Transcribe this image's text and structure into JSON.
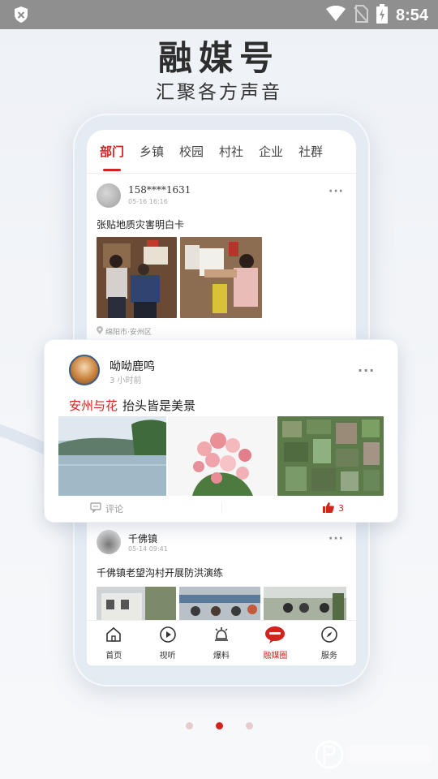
{
  "status_bar": {
    "time": "8:54"
  },
  "headline": {
    "title": "融媒号",
    "subtitle": "汇聚各方声音"
  },
  "tabs": [
    {
      "label": "部门",
      "active": true
    },
    {
      "label": "乡镇"
    },
    {
      "label": "校园"
    },
    {
      "label": "村社"
    },
    {
      "label": "企业"
    },
    {
      "label": "社群"
    }
  ],
  "post1": {
    "user": "158****1631",
    "time": "05-16 16:16",
    "title": "张贴地质灾害明白卡",
    "location": "绵阳市·安州区"
  },
  "featured_post": {
    "user": "呦呦鹿鸣",
    "time": "3 小时前",
    "tag": "安州与花",
    "title": "抬头皆是美景",
    "comment_label": "评论",
    "like_count": "3"
  },
  "post3": {
    "user": "千佛镇",
    "time": "05-14 09:41",
    "title": "千佛镇老望沟村开展防洪演练"
  },
  "nav": [
    {
      "label": "首页",
      "icon": "home-icon"
    },
    {
      "label": "视听",
      "icon": "play-icon"
    },
    {
      "label": "爆料",
      "icon": "bell-icon"
    },
    {
      "label": "融媒圈",
      "icon": "chat-bubble-icon",
      "active": true
    },
    {
      "label": "服务",
      "icon": "compass-icon"
    }
  ],
  "pager": {
    "total": 3,
    "current": 2
  },
  "colors": {
    "accent": "#d2231d",
    "status_bar": "#8f8f8f",
    "phone_frame": "#e4ebf3"
  }
}
